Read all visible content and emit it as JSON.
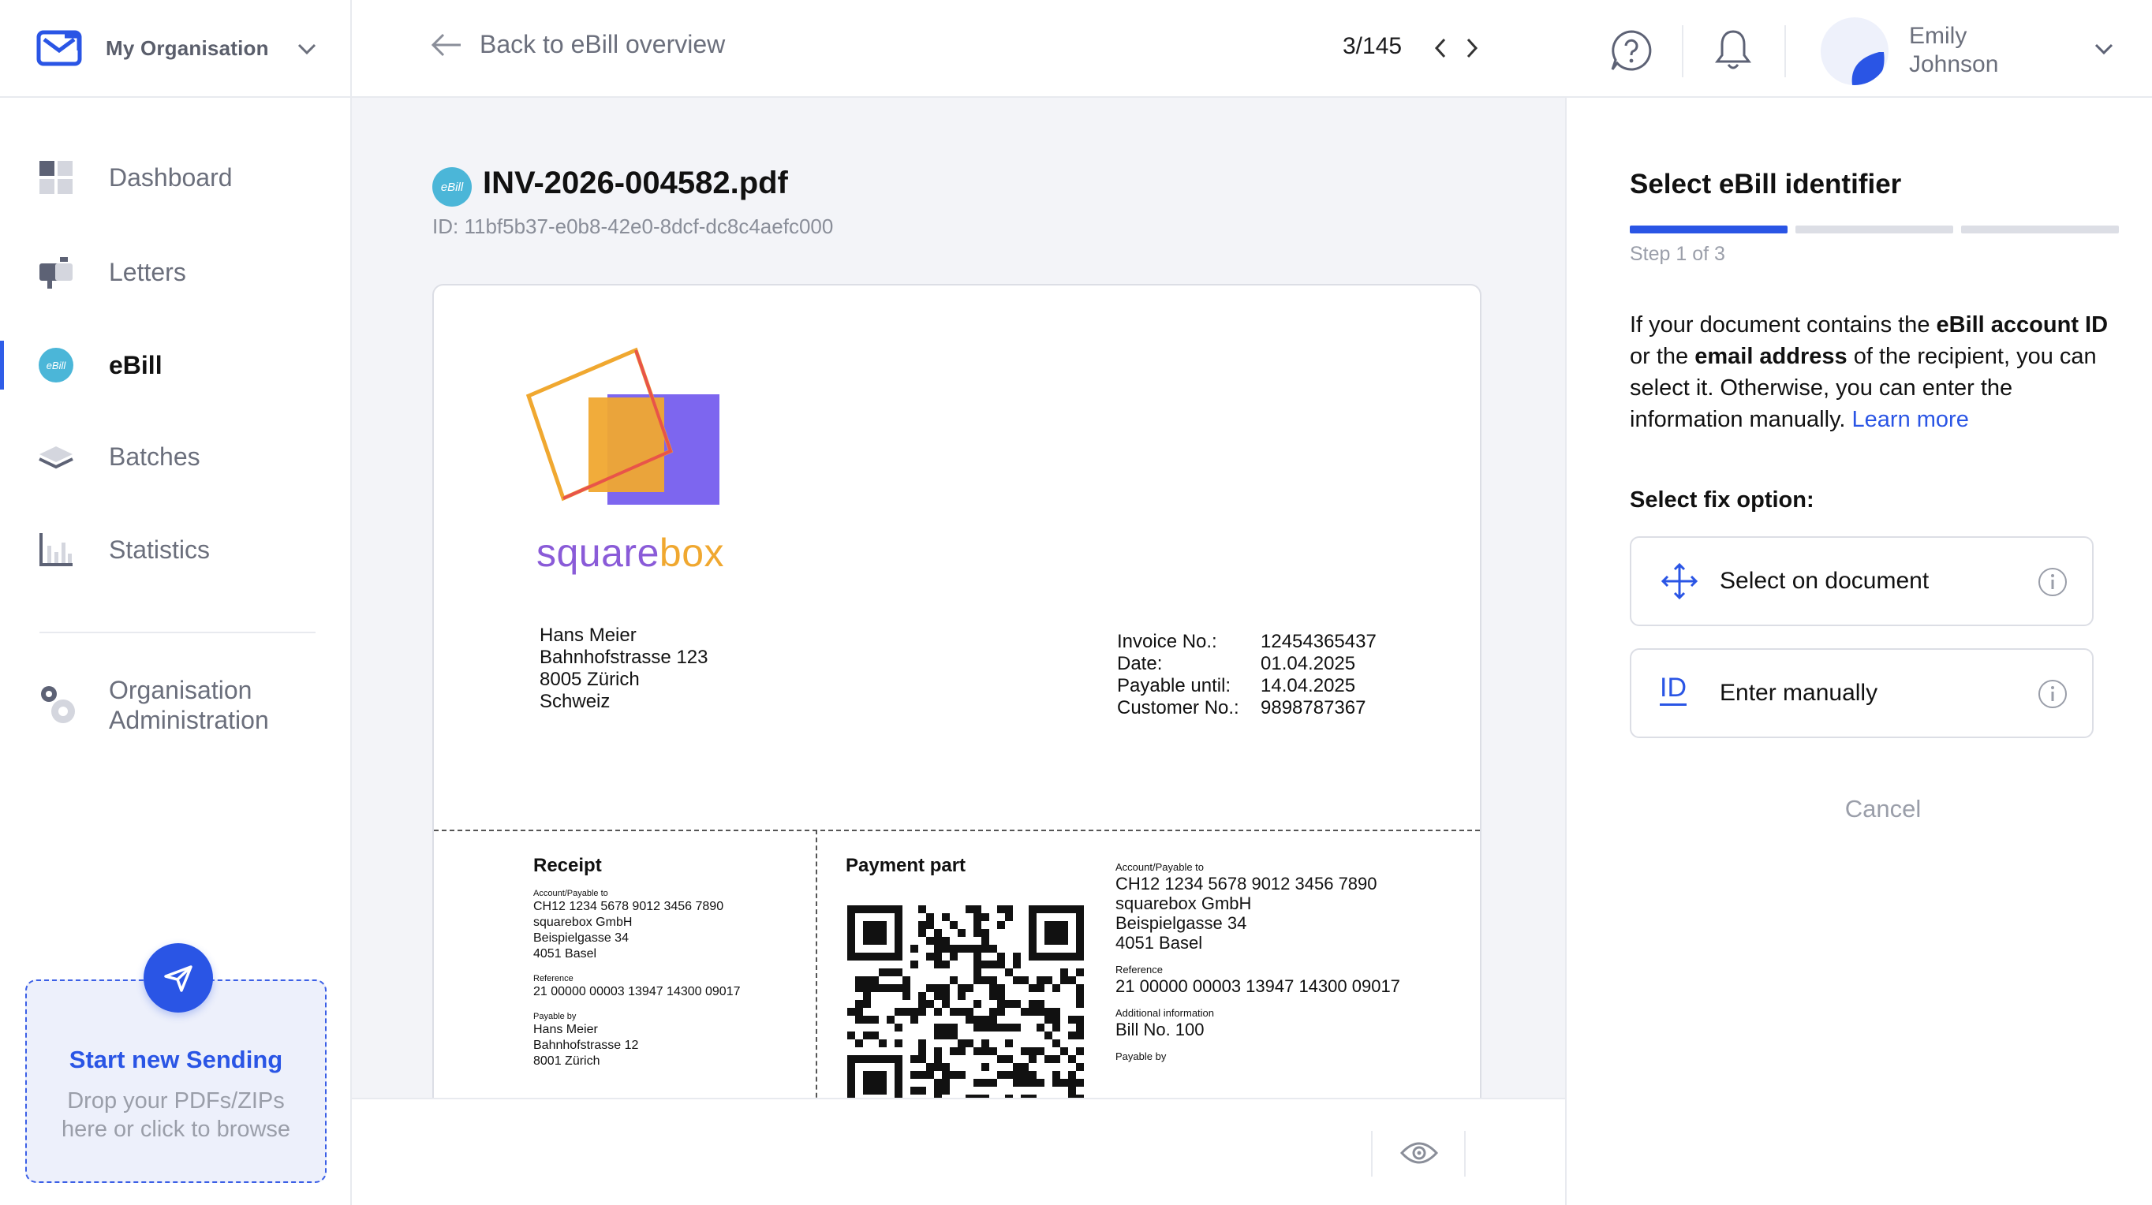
{
  "sidebar": {
    "org_name": "My Organisation",
    "nav": [
      {
        "label": "Dashboard",
        "icon": "dashboard-icon"
      },
      {
        "label": "Letters",
        "icon": "mailbox-icon"
      },
      {
        "label": "eBill",
        "icon": "ebill-icon"
      },
      {
        "label": "Batches",
        "icon": "layers-icon"
      },
      {
        "label": "Statistics",
        "icon": "bar-chart-icon"
      }
    ],
    "org_admin_line1": "Organisation",
    "org_admin_line2": "Administration",
    "dropzone_title": "Start new Sending",
    "dropzone_line1": "Drop your PDFs/ZIPs",
    "dropzone_line2": "here or click to browse"
  },
  "topbar": {
    "back_label": "Back to eBill overview",
    "pager": "3/145",
    "user_first": "Emily",
    "user_last": "Johnson"
  },
  "document": {
    "badge": "eBill",
    "file_name": "INV-2026-004582.pdf",
    "file_id": "ID: 11bf5b37-e0b8-42e0-8dcf-dc8c4aefc000",
    "logo_part1": "square",
    "logo_part2": "box",
    "recipient": [
      "Hans Meier",
      "Bahnhofstrasse 123",
      "8005 Zürich",
      "Schweiz"
    ],
    "meta": [
      {
        "k": "Invoice No.:",
        "v": "12454365437"
      },
      {
        "k": "Date:",
        "v": "01.04.2025"
      },
      {
        "k": "Payable until:",
        "v": "14.04.2025"
      },
      {
        "k": "Customer No.:",
        "v": "9898787367"
      }
    ],
    "receipt": {
      "title": "Receipt",
      "acct_label": "Account/Payable to",
      "acct": [
        "CH12 1234 5678 9012 3456 7890",
        "squarebox GmbH",
        "Beispielgasse 34",
        "4051 Basel"
      ],
      "ref_label": "Reference",
      "ref": "21 00000 00003 13947 14300 09017",
      "payable_by_label": "Payable by",
      "payable_by": [
        "Hans Meier",
        "Bahnhofstrasse 12",
        "8001 Zürich"
      ]
    },
    "payment": {
      "title": "Payment part",
      "acct_label": "Account/Payable to",
      "acct": [
        "CH12 1234 5678 9012 3456 7890",
        "squarebox GmbH",
        "Beispielgasse 34",
        "4051 Basel"
      ],
      "ref_label": "Reference",
      "ref": "21 00000 00003 13947 14300 09017",
      "add_label": "Additional information",
      "add": "Bill No. 100",
      "payable_by_label": "Payable by"
    }
  },
  "panel": {
    "title": "Select eBill identifier",
    "step": "Step 1 of 3",
    "desc_1": "If your document contains the ",
    "desc_b1": "eBill account ID",
    "desc_2": " or the ",
    "desc_b2": "email address",
    "desc_3": " of the recipient, you can select it. Otherwise, you can enter the information manually. ",
    "learn_more": "Learn more",
    "fix_label": "Select fix option:",
    "opt1": "Select on document",
    "opt2": "Enter manually",
    "opt2_icon_text": "ID",
    "cancel": "Cancel"
  },
  "colors": {
    "accent": "#2a55e5",
    "ebill_badge": "#4bb6d8"
  }
}
